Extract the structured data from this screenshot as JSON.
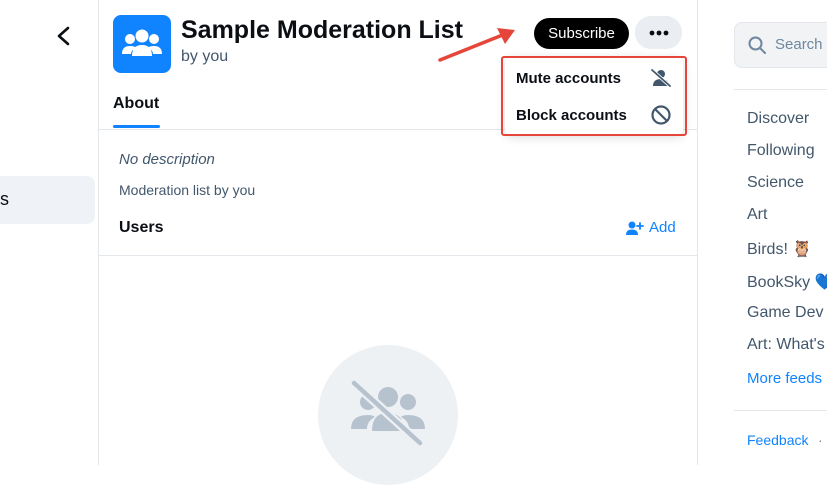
{
  "header": {
    "title": "Sample Moderation List",
    "byline": "by you",
    "subscribe_label": "Subscribe"
  },
  "left_nav": {
    "active_item_label": "ons"
  },
  "tabs": [
    {
      "label": "About"
    }
  ],
  "about": {
    "description": "No description",
    "list_type": "Moderation list by you",
    "users_label": "Users",
    "add_label": "Add"
  },
  "dropdown": {
    "items": [
      {
        "label": "Mute accounts",
        "icon": "person-mute-icon"
      },
      {
        "label": "Block accounts",
        "icon": "block-icon"
      }
    ]
  },
  "right_sidebar": {
    "search_placeholder": "Search",
    "feeds": [
      "Discover",
      "Following",
      "Science",
      "Art",
      "Birds! 🦉",
      "BookSky 💙",
      "Game Dev",
      "Art: What's"
    ],
    "more_feeds_label": "More feeds",
    "feedback_label": "Feedback",
    "feedback_sep": "·"
  },
  "colors": {
    "accent": "#1083fe",
    "annotation_red": "#e6453a",
    "subscribe_bg": "#000000"
  }
}
